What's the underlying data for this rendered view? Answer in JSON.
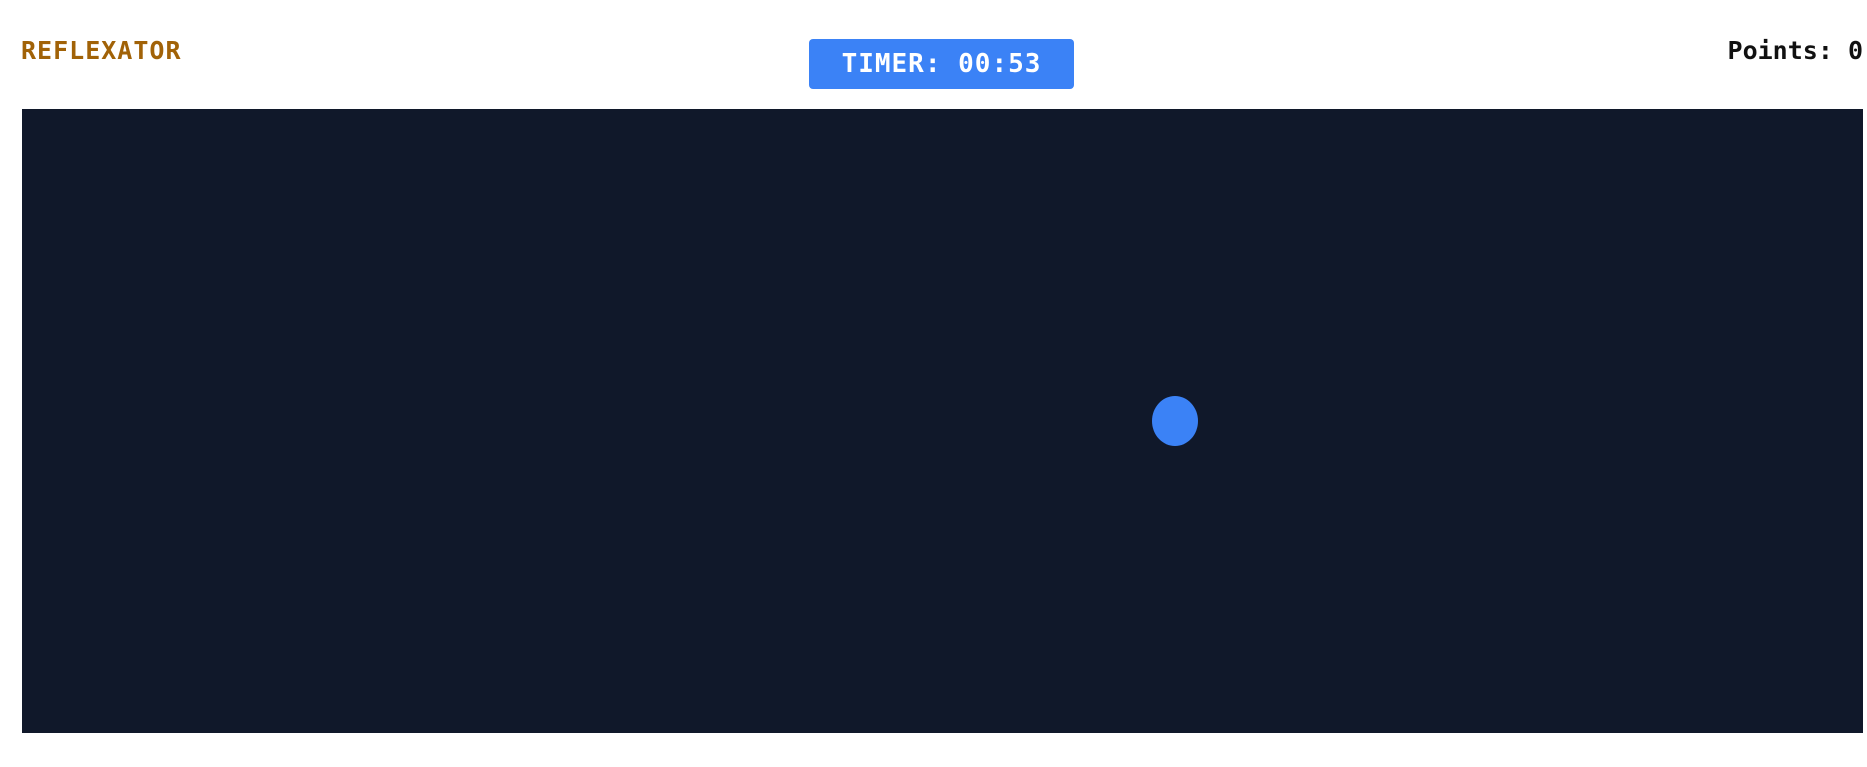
{
  "header": {
    "title": "REFLEXATOR",
    "timer_label": "TIMER:",
    "timer_value": "00:53",
    "points_label": "Points:",
    "points_value": "0"
  },
  "game": {
    "target_color": "#3b82f6",
    "background_color": "#10182a"
  },
  "colors": {
    "title": "#a16207",
    "timer_bg": "#3b82f6",
    "timer_text": "#ffffff",
    "points_text": "#111111"
  }
}
